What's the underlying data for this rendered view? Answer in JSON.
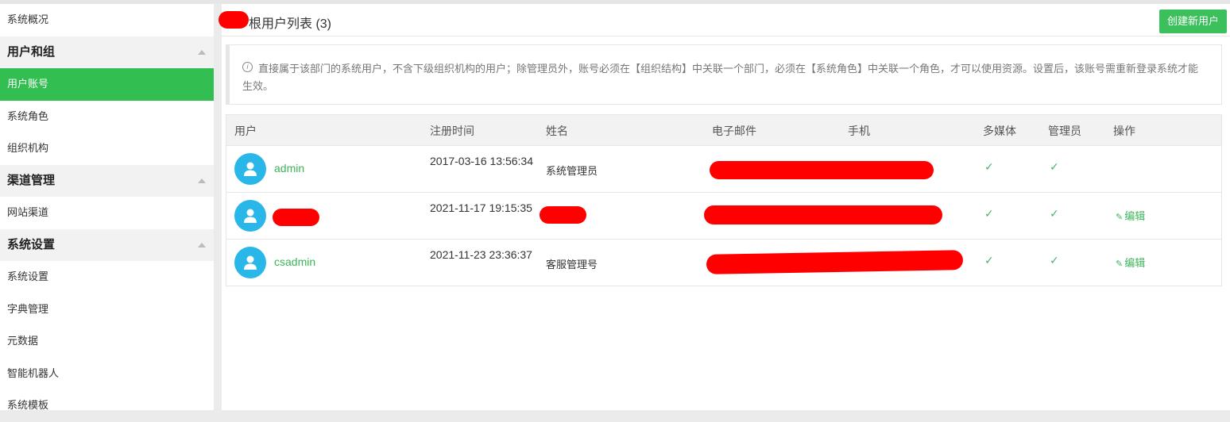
{
  "sidebar": {
    "items": [
      {
        "label": "系统概况",
        "type": "item"
      },
      {
        "label": "用户和组",
        "type": "group"
      },
      {
        "label": "用户账号",
        "type": "item",
        "active": true
      },
      {
        "label": "系统角色",
        "type": "item"
      },
      {
        "label": "组织机构",
        "type": "item"
      },
      {
        "label": "渠道管理",
        "type": "group"
      },
      {
        "label": "网站渠道",
        "type": "item"
      },
      {
        "label": "系统设置",
        "type": "group"
      },
      {
        "label": "系统设置",
        "type": "item"
      },
      {
        "label": "字典管理",
        "type": "item"
      },
      {
        "label": "元数据",
        "type": "item"
      },
      {
        "label": "智能机器人",
        "type": "item"
      },
      {
        "label": "系统模板",
        "type": "item"
      }
    ]
  },
  "header": {
    "title": "根用户列表 (3)",
    "create_button": "创建新用户"
  },
  "notice": {
    "text": "直接属于该部门的系统用户，不含下级组织机构的用户；除管理员外，账号必须在【组织结构】中关联一个部门，必须在【系统角色】中关联一个角色，才可以使用资源。设置后，该账号需重新登录系统才能生效。"
  },
  "table": {
    "headers": {
      "user": "用户",
      "regtime": "注册时间",
      "name": "姓名",
      "email": "电子邮件",
      "phone": "手机",
      "multimedia": "多媒体",
      "admin": "管理员",
      "actions": "操作"
    },
    "rows": [
      {
        "username": "admin",
        "regtime": "2017-03-16 13:56:34",
        "name": "系统管理员",
        "multimedia": "✓",
        "admin": "✓",
        "edit": ""
      },
      {
        "username": "",
        "regtime": "2021-11-17 19:15:35",
        "name": "",
        "multimedia": "✓",
        "admin": "✓",
        "edit": "编辑"
      },
      {
        "username": "csadmin",
        "regtime": "2021-11-23 23:36:37",
        "name": "客服管理号",
        "multimedia": "✓",
        "admin": "✓",
        "edit": "编辑"
      }
    ]
  },
  "colors": {
    "accent": "#32be50",
    "link": "#3cb55a",
    "avatar": "#29b6e8",
    "redaction": "#ff0000"
  }
}
